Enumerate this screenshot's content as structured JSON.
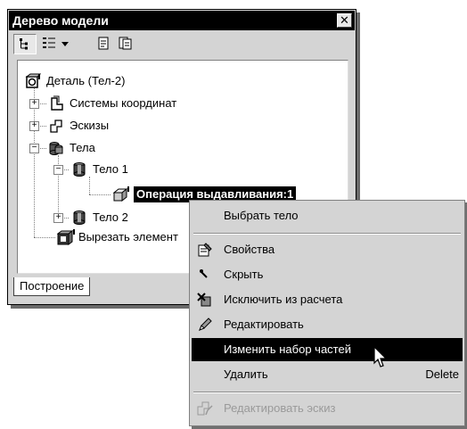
{
  "window": {
    "title": "Дерево модели",
    "close_glyph": "✕"
  },
  "toolbar": {
    "tree_view_icon": "tree-structure-icon",
    "list_view_icon": "list-view-icon",
    "dropdown_icon": "dropdown-arrow-icon",
    "doc_icon": "document-icon",
    "doc2_icon": "document-copy-icon"
  },
  "tree": {
    "root": "Деталь (Тел-2)",
    "items": [
      {
        "label": "Системы координат"
      },
      {
        "label": "Эскизы"
      },
      {
        "label": "Тела"
      },
      {
        "label": "Тело 1"
      },
      {
        "label": "Операция выдавливания:1"
      },
      {
        "label": "Тело 2"
      },
      {
        "label": "Вырезать элемент"
      }
    ]
  },
  "tabs": {
    "active": "Построение"
  },
  "context_menu": {
    "items": [
      {
        "label": "Выбрать тело",
        "shortcut": ""
      },
      {
        "label": "Свойства",
        "shortcut": ""
      },
      {
        "label": "Скрыть",
        "shortcut": ""
      },
      {
        "label": "Исключить из расчета",
        "shortcut": ""
      },
      {
        "label": "Редактировать",
        "shortcut": ""
      },
      {
        "label": "Изменить набор частей",
        "shortcut": ""
      },
      {
        "label": "Удалить",
        "shortcut": "Delete"
      },
      {
        "label": "Редактировать эскиз",
        "shortcut": ""
      }
    ],
    "highlighted_index": 5,
    "disabled_index": 7
  },
  "colors": {
    "selection": "#000000",
    "panel_bg": "#d4d4d4",
    "disabled_text": "#9a9a9a"
  }
}
